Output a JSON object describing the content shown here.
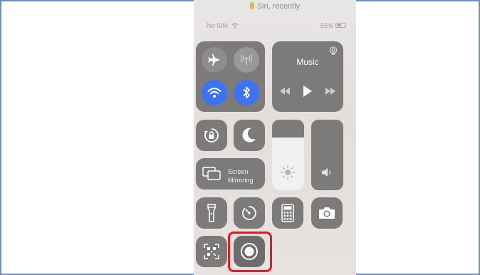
{
  "siri_banner": "Siri, recently",
  "status": {
    "carrier": "No SIM",
    "battery": "55%"
  },
  "music": {
    "title": "Music"
  },
  "screen_mirroring": {
    "line1": "Screen",
    "line2": "Mirroring"
  },
  "brightness": {
    "level": 0.75
  },
  "volume": {
    "level": 0.0
  },
  "colors": {
    "accent_blue": "#3c73f0",
    "highlight_red": "#e31b23"
  },
  "icons": [
    "microphone-icon",
    "wifi-icon",
    "airplane-icon",
    "cellular-icon",
    "bluetooth-icon",
    "airplay-icon",
    "rewind-icon",
    "play-icon",
    "fast-forward-icon",
    "rotation-lock-icon",
    "moon-icon",
    "screen-mirroring-icon",
    "sun-icon",
    "speaker-icon",
    "flashlight-icon",
    "timer-icon",
    "calculator-icon",
    "camera-icon",
    "qr-code-icon",
    "screen-record-icon"
  ]
}
